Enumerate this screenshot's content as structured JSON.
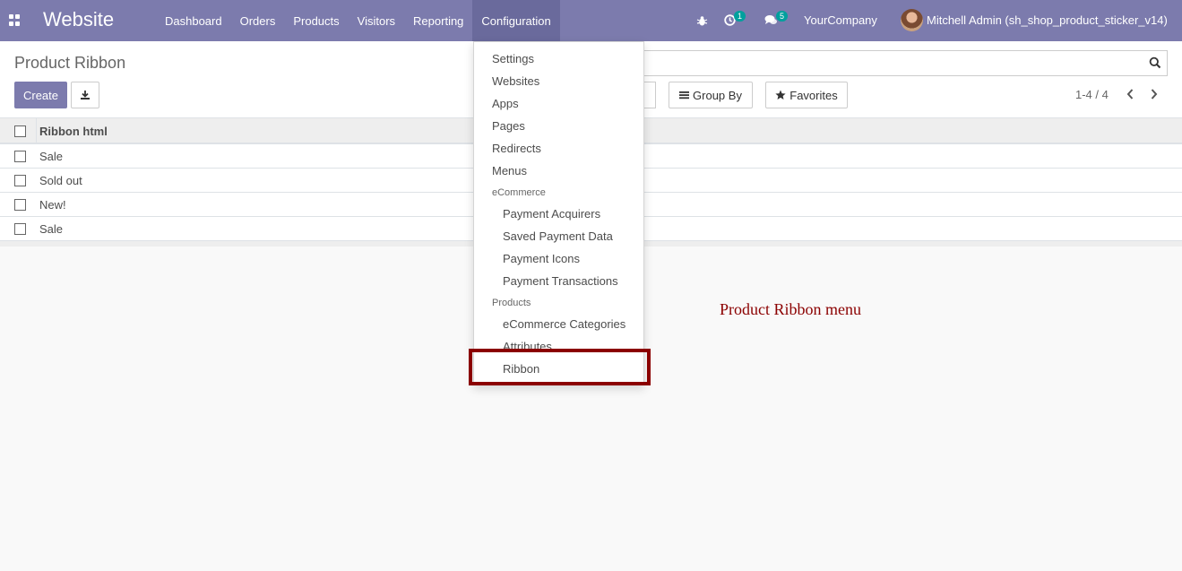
{
  "navbar": {
    "brand": "Website",
    "menu": [
      "Dashboard",
      "Orders",
      "Products",
      "Visitors",
      "Reporting",
      "Configuration"
    ],
    "active_menu": "Configuration",
    "activity_count": "1",
    "message_count": "5",
    "company": "YourCompany",
    "user": "Mitchell Admin (sh_shop_product_sticker_v14)"
  },
  "control_panel": {
    "title": "Product Ribbon",
    "create_label": "Create",
    "group_by_label": "Group By",
    "favorites_label": "Favorites",
    "pager": "1-4 / 4"
  },
  "list": {
    "column": "Ribbon html",
    "rows": [
      "Sale",
      "Sold out",
      "New!",
      "Sale"
    ]
  },
  "dropdown": {
    "items": [
      "Settings",
      "Websites",
      "Apps",
      "Pages",
      "Redirects",
      "Menus"
    ],
    "ecommerce_header": "eCommerce",
    "ecommerce_items": [
      "Payment Acquirers",
      "Saved Payment Data",
      "Payment Icons",
      "Payment Transactions"
    ],
    "products_header": "Products",
    "products_items": [
      "eCommerce Categories",
      "Attributes",
      "Ribbon"
    ]
  },
  "annotation": "Product Ribbon menu",
  "colors": {
    "navbar": "#7c7bad",
    "active_menu": "#6a6a9c",
    "badge": "#00a09d",
    "highlight": "#8b0000"
  },
  "icons": {
    "apps": "apps-grid-icon",
    "debug": "bug-icon",
    "activity": "clock-icon",
    "messages": "chat-icon",
    "download": "download-icon",
    "search": "search-icon",
    "group_by": "bars-icon",
    "favorites": "star-icon",
    "pager_prev": "chevron-left-icon",
    "pager_next": "chevron-right-icon"
  }
}
